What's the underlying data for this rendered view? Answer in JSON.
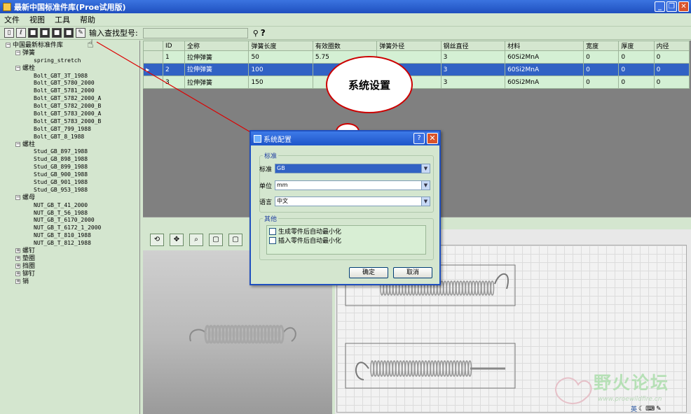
{
  "window": {
    "title": "最新中国标准件库(Proe试用版)",
    "minimize": "_",
    "restore": "❐",
    "close": "✕"
  },
  "menu": [
    "文件",
    "视图",
    "工具",
    "帮助"
  ],
  "toolbar": {
    "search_label": "输入查找型号:",
    "search_value": ""
  },
  "tree": {
    "root": "中国最新标准件库",
    "groups": [
      {
        "label": "弹簧",
        "expanded": true,
        "children": [
          "spring_stretch"
        ]
      },
      {
        "label": "螺栓",
        "expanded": true,
        "children": [
          "Bolt_GBT_3T_1988",
          "Bolt_GBT_5780_2000",
          "Bolt_GBT_5781_2000",
          "Bolt_GBT_5782_2000_A",
          "Bolt_GBT_5782_2000_B",
          "Bolt_GBT_5783_2000_A",
          "Bolt_GBT_5783_2000_B",
          "Bolt_GBT_799_1988",
          "Bolt_GBT_8_1988"
        ]
      },
      {
        "label": "螺柱",
        "expanded": true,
        "children": [
          "Stud_GB_897_1988",
          "Stud_GB_898_1988",
          "Stud_GB_899_1988",
          "Stud_GB_900_1988",
          "Stud_GB_901_1988",
          "Stud_GB_953_1988"
        ]
      },
      {
        "label": "螺母",
        "expanded": true,
        "children": [
          "NUT_GB_T_41_2000",
          "NUT_GB_T_56_1988",
          "NUT_GB_T_6170_2000",
          "NUT_GB_T_6172_1_2000",
          "NUT_GB_T_810_1988",
          "NUT_GB_T_812_1988"
        ]
      },
      {
        "label": "螺钉",
        "expanded": false,
        "children": []
      },
      {
        "label": "垫圈",
        "expanded": false,
        "children": []
      },
      {
        "label": "挡圈",
        "expanded": false,
        "children": []
      },
      {
        "label": "铆钉",
        "expanded": false,
        "children": []
      },
      {
        "label": "销",
        "expanded": false,
        "children": []
      }
    ]
  },
  "table": {
    "columns": [
      "ID",
      "全称",
      "弹簧长度",
      "有效圈数",
      "弹簧外径",
      "钢丝直径",
      "材料",
      "宽度",
      "厚度",
      "内径"
    ],
    "rows": [
      [
        "1",
        "拉伸弹簧",
        "50",
        "5.75",
        "",
        "3",
        "60Si2MnA",
        "0",
        "0",
        "0"
      ],
      [
        "2",
        "拉伸弹簧",
        "100",
        "",
        "",
        "3",
        "60Si2MnA",
        "0",
        "0",
        "0"
      ],
      [
        "3",
        "拉伸弹簧",
        "150",
        "",
        "",
        "3",
        "60Si2MnA",
        "0",
        "0",
        "0"
      ]
    ],
    "selected_row": 1
  },
  "callout": {
    "text": "系统设置"
  },
  "dialog": {
    "title": "系统配置",
    "help": "?",
    "close": "✕",
    "group_standard": "标准",
    "fields": [
      {
        "label": "标准",
        "value": "GB"
      },
      {
        "label": "单位",
        "value": "mm"
      },
      {
        "label": "语言",
        "value": "中文"
      }
    ],
    "group_other": "其他",
    "checkboxes": [
      "生成零件后自动最小化",
      "插入零件后自动最小化"
    ],
    "ok": "确定",
    "cancel": "取消"
  },
  "watermark": {
    "text": "野火论坛",
    "url": "www.proewildfire.cn"
  },
  "status": {
    "ime": "英"
  }
}
